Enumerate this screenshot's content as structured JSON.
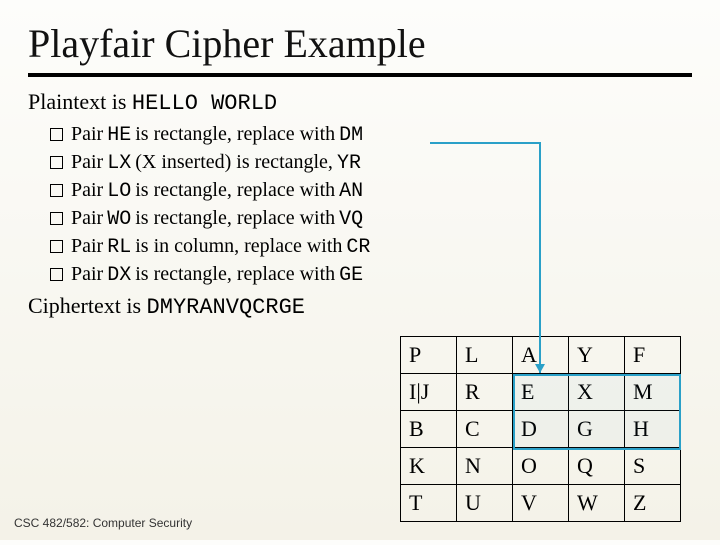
{
  "title": "Playfair Cipher Example",
  "plaintext_label": "Plaintext is ",
  "plaintext_value": "HELLO WORLD",
  "bullets": [
    {
      "prefix": "Pair ",
      "pair": "HE",
      "rest": " is rectangle, replace with ",
      "sub": "DM"
    },
    {
      "prefix": "Pair ",
      "pair": "LX",
      "rest": " (X inserted) is rectangle, ",
      "sub": "YR"
    },
    {
      "prefix": "Pair ",
      "pair": "LO",
      "rest": " is rectangle, replace with ",
      "sub": "AN"
    },
    {
      "prefix": "Pair ",
      "pair": "WO",
      "rest": " is rectangle, replace with ",
      "sub": "VQ"
    },
    {
      "prefix": "Pair ",
      "pair": "RL",
      "rest": " is in column, replace with ",
      "sub": "CR"
    },
    {
      "prefix": "Pair ",
      "pair": "DX",
      "rest": " is rectangle, replace with ",
      "sub": "GE"
    }
  ],
  "ciphertext_label": "Ciphertext is ",
  "ciphertext_value": "DMYRANVQCRGE",
  "table": [
    [
      "P",
      "L",
      "A",
      "Y",
      "F"
    ],
    [
      "I|J",
      "R",
      "E",
      "X",
      "M"
    ],
    [
      "B",
      "C",
      "D",
      "G",
      "H"
    ],
    [
      "K",
      "N",
      "O",
      "Q",
      "S"
    ],
    [
      "T",
      "U",
      "V",
      "W",
      "Z"
    ]
  ],
  "footer": "CSC 482/582: Computer Security",
  "accent_color": "#2aa0c8"
}
